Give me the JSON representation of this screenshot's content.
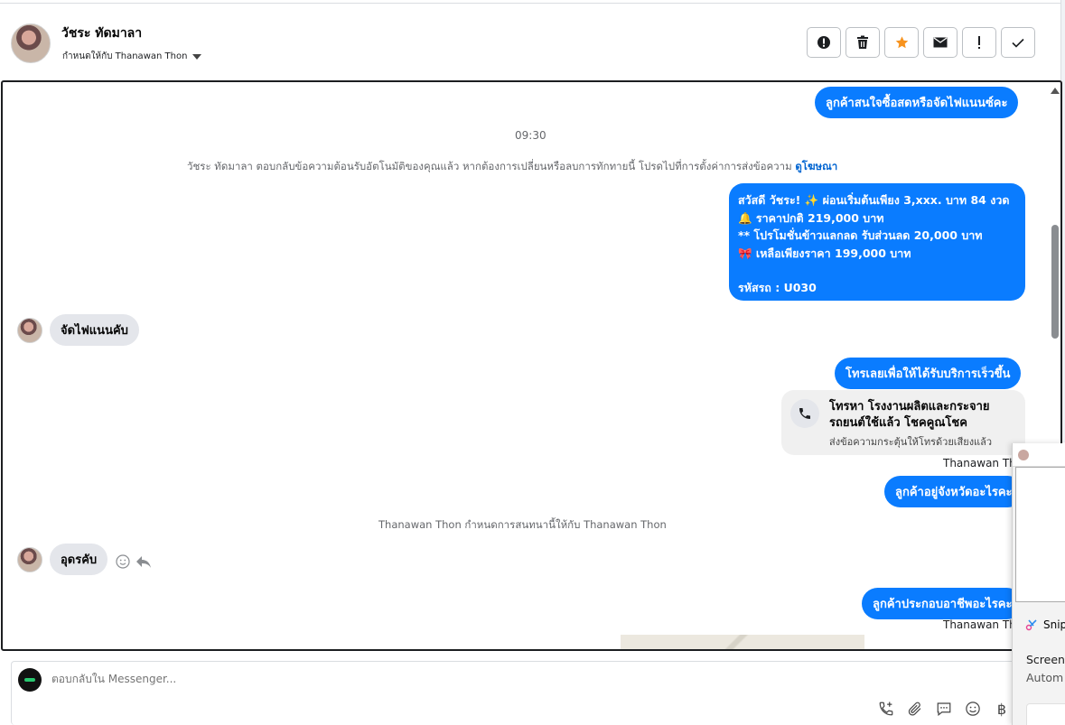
{
  "header": {
    "contact_name": "วัชระ ทัดมาลา",
    "assigned_label": "กำหนดให้กับ Thanawan Thon",
    "actions": [
      {
        "icon": "alert-circle-icon",
        "name": "spam-button"
      },
      {
        "icon": "trash-icon",
        "name": "delete-button"
      },
      {
        "icon": "star-icon",
        "name": "star-button"
      },
      {
        "icon": "envelope-icon",
        "name": "mark-unread-button"
      },
      {
        "icon": "exclamation-icon",
        "name": "follow-up-button"
      },
      {
        "icon": "check-icon",
        "name": "mark-done-button"
      }
    ],
    "star_color": "#f7931e"
  },
  "chat": {
    "messages": {
      "out_top": "ลูกค้าสนใจซื้อสดหรือจัดไฟแนนซ์คะ",
      "timestamp": "09:30",
      "system_auto_reply": "วัชระ ทัดมาลา ตอบกลับข้อความต้อนรับอัตโนมัติของคุณแล้ว หากต้องการเปลี่ยนหรือลบการทักทายนี้ โปรดไปที่การตั้งค่าการส่งข้อความ",
      "system_link": "ดูโฆษณา",
      "promo_lines": [
        "สวัสดี วัชระ! ✨  ผ่อนเริ่มต้นเพียง 3,xxx. บาท 84 งวด",
        "🔔 ราคาปกติ  219,000 บาท",
        "** โปรโมชั่นข้าวแลกลด รับส่วนลด 20,000 บาท",
        "🎀  เหลือเพียงราคา 199,000 บาท",
        "",
        " รหัสรถ : U030"
      ],
      "in_finance": "จัดไฟแนนคับ",
      "out_call_prompt": "โทรเลยเพื่อให้ได้รับบริการเร็วขึ้น",
      "call_card_title": "โทรหา โรงงานผลิตและกระจายรถยนต์ใช้แล้ว โชคคูณโชค",
      "call_card_sub": "ส่งข้อความกระตุ้นให้โทรด้วยเสียงแล้ว",
      "sender_1": "Thanawan Thon",
      "out_province": "ลูกค้าอยู่จังหวัดอะไรคะ",
      "system_assign": "Thanawan Thon กำหนดการสนทนานี้ให้กับ Thanawan Thon",
      "in_province": "อุดรคับ",
      "out_job": "ลูกค้าประกอบอาชีพอะไรคะ",
      "sender_2": "Thanawan Thon"
    },
    "accent_color": "#0a7cff"
  },
  "composer": {
    "placeholder": "ตอบกลับใน Messenger...",
    "tools": [
      "call-add-icon",
      "attach-icon",
      "saved-reply-icon",
      "emoji-icon",
      "baht-icon"
    ],
    "baht_symbol": "฿"
  },
  "notification": {
    "app_name": "Snip",
    "title": "Screens",
    "subtitle": "Autom"
  }
}
